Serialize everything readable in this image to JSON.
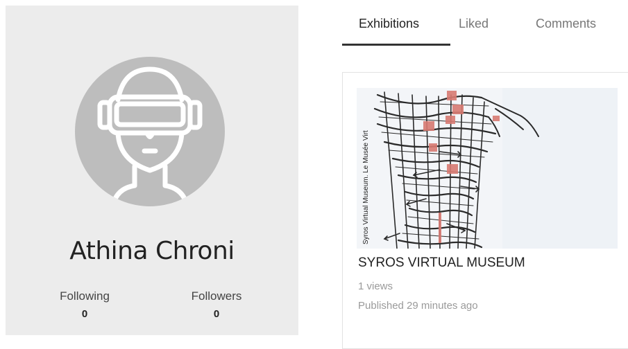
{
  "profile": {
    "name": "Athina Chroni",
    "avatar_icon": "vr-headset-user-icon",
    "following_label": "Following",
    "following_count": "0",
    "followers_label": "Followers",
    "followers_count": "0"
  },
  "tabs": [
    {
      "label": "Exhibitions",
      "active": true
    },
    {
      "label": "Liked",
      "active": false
    },
    {
      "label": "Comments",
      "active": false
    }
  ],
  "exhibition": {
    "title": "SYROS VIRTUAL MUSEUM",
    "views": "1 views",
    "published": "Published 29 minutes ago",
    "thumbnail_caption": "Syros Virtual Museum. Le Musée Virt"
  },
  "colors": {
    "card_bg": "#ececec",
    "avatar_bg": "#bdbdbd",
    "map_highlight": "#d87a72"
  }
}
